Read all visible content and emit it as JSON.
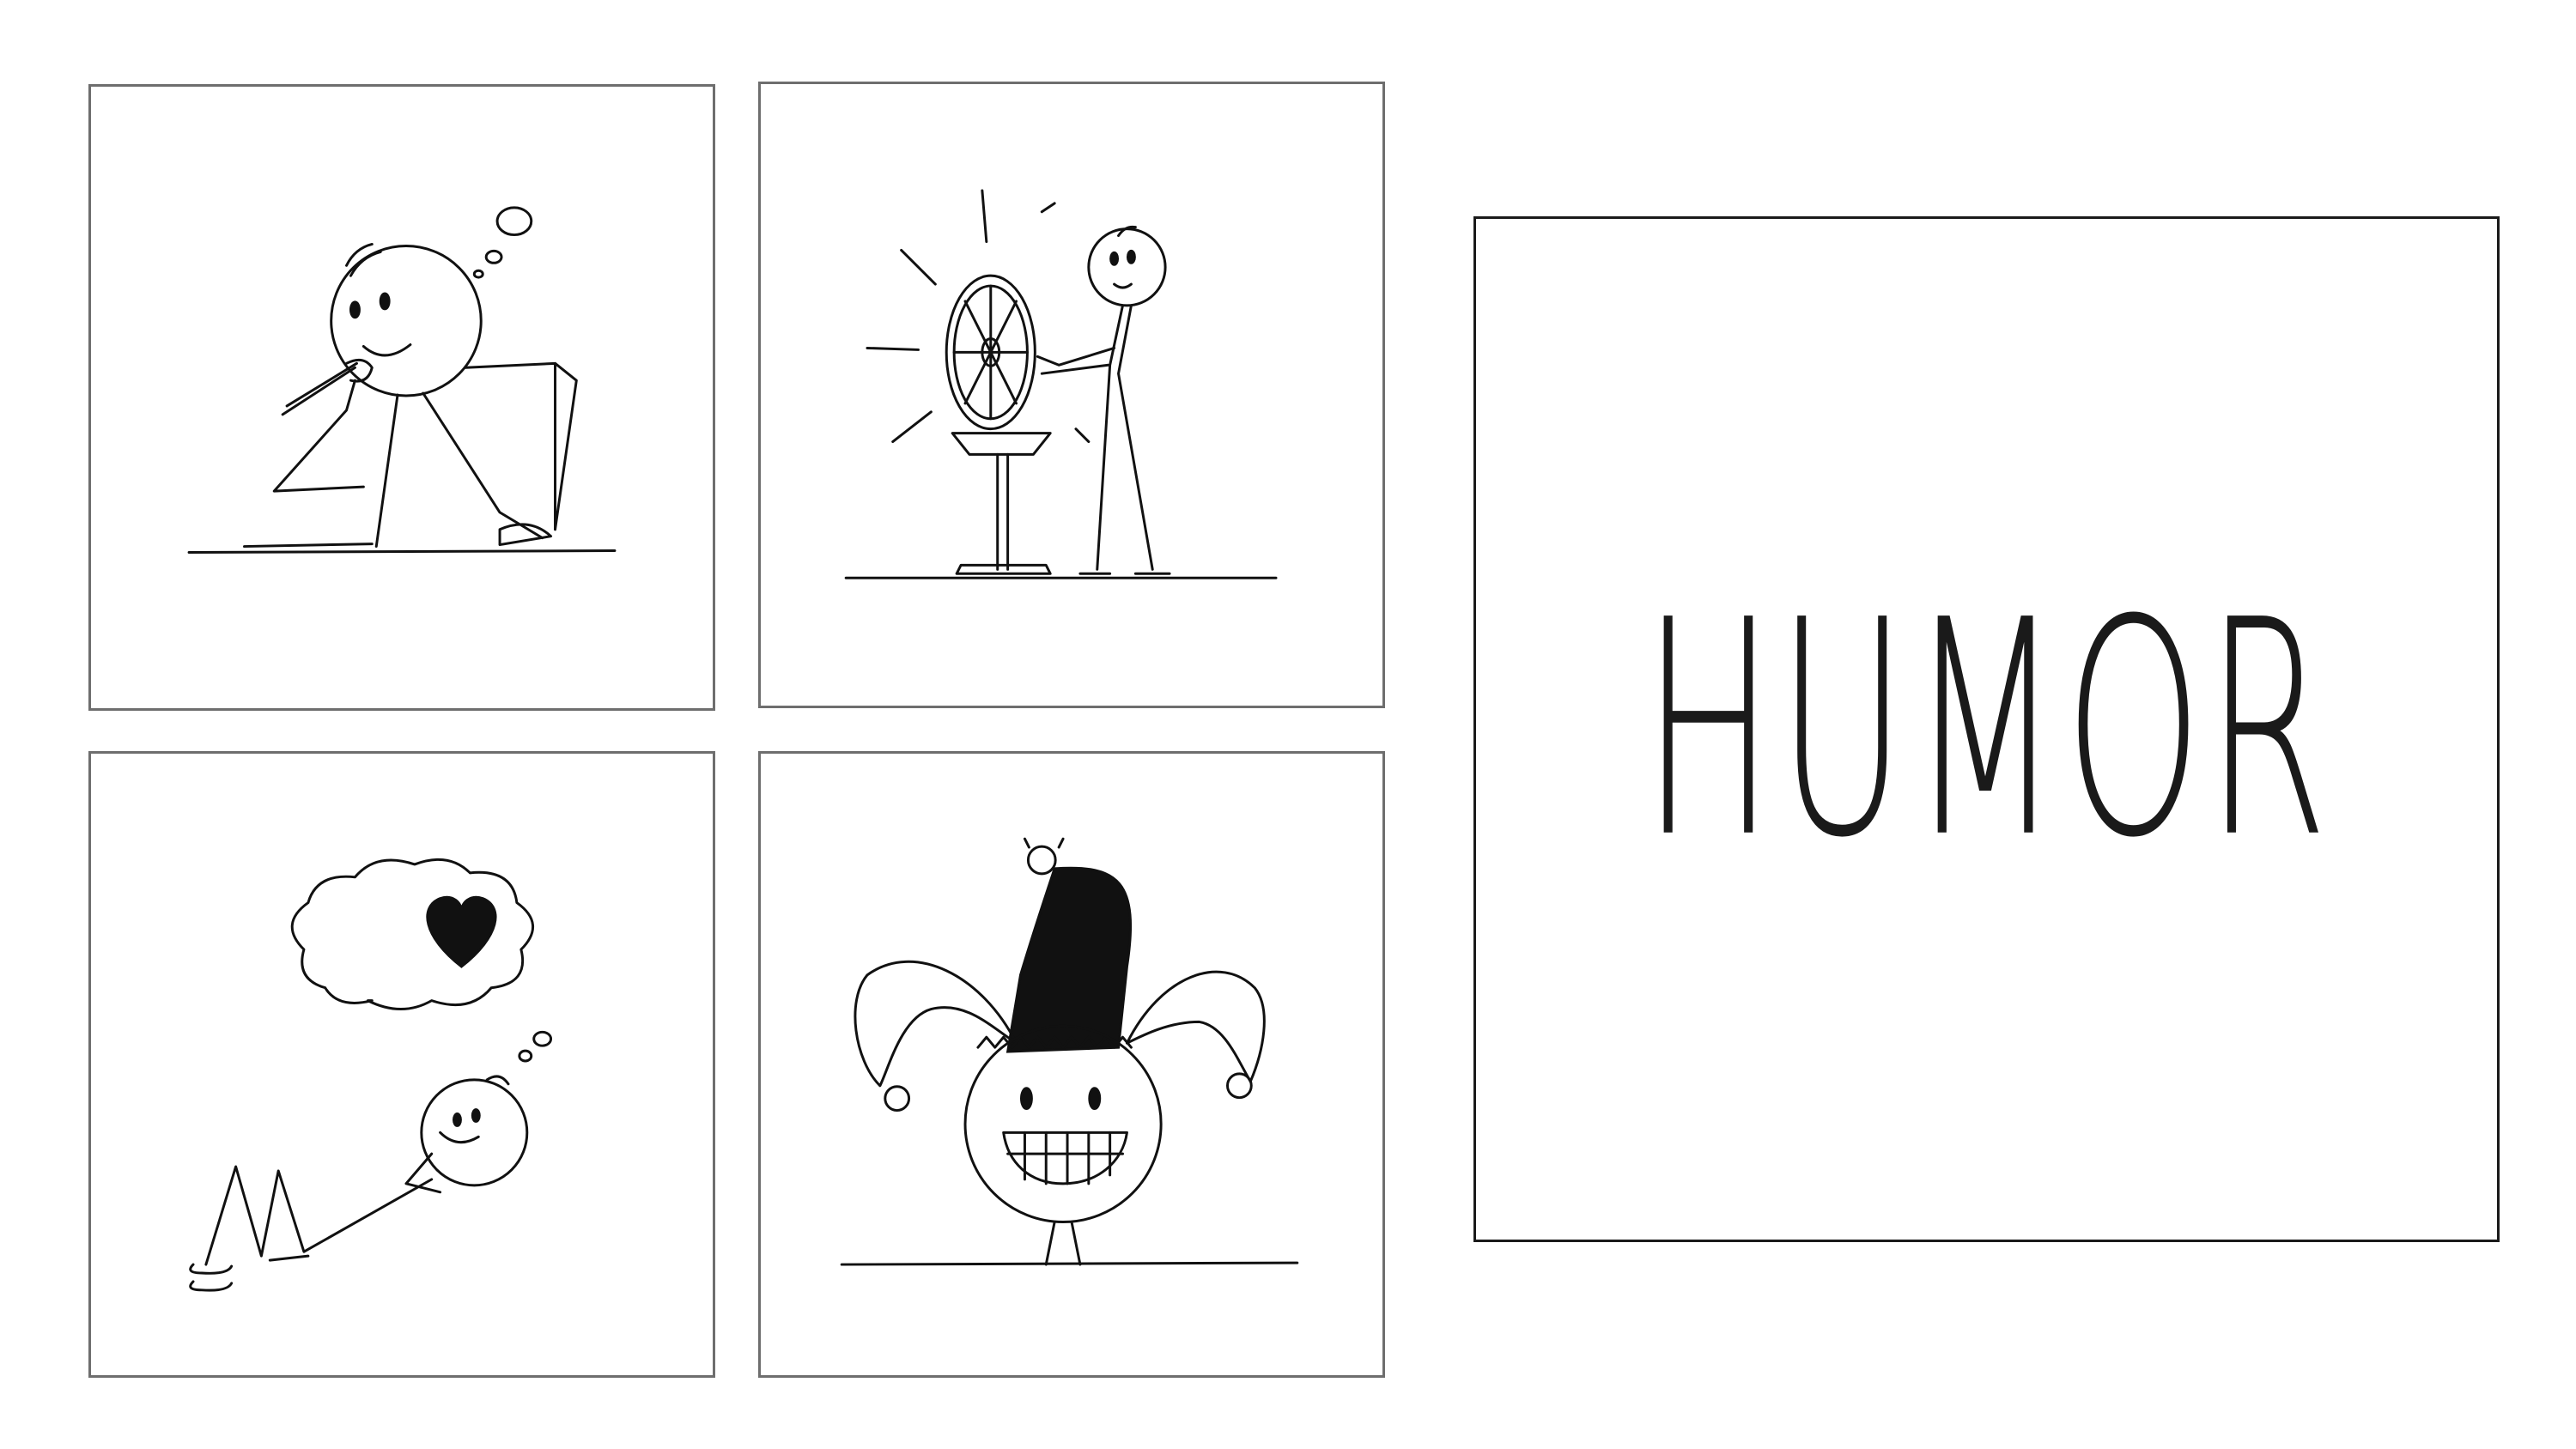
{
  "slide": {
    "title": "HUMOR"
  },
  "illustrations": [
    {
      "icon": "thinking-stick-figure-icon"
    },
    {
      "icon": "spinning-wheel-stick-figure-icon"
    },
    {
      "icon": "daydreaming-heart-stick-figure-icon"
    },
    {
      "icon": "jester-hat-stick-figure-icon"
    }
  ],
  "colors": {
    "ink": "#111111",
    "panel_border": "#6e6e6e",
    "background": "#ffffff"
  }
}
